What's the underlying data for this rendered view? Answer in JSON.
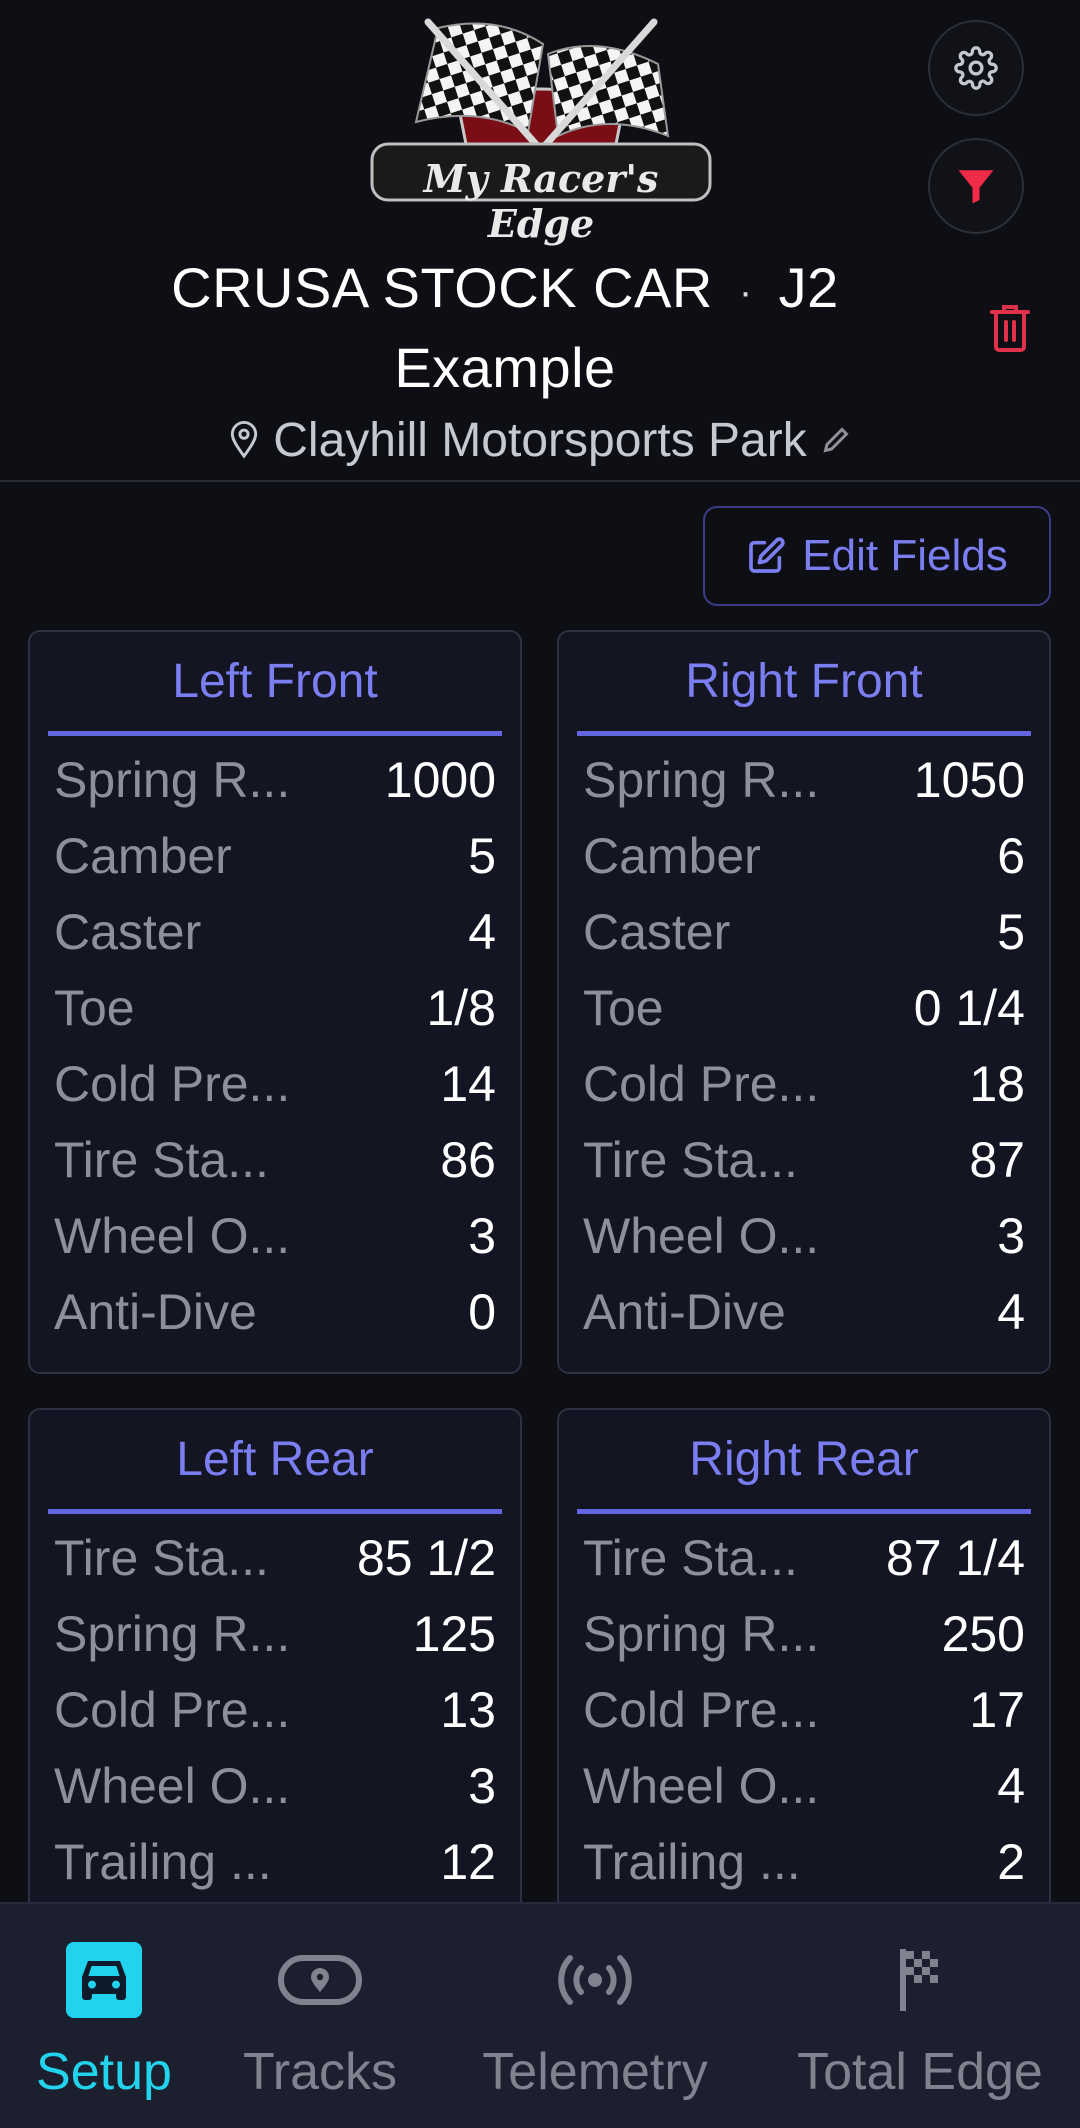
{
  "header": {
    "logo_text": "My Racer's Edge",
    "title_line1_left": "CRUSA STOCK CAR",
    "title_separator": "·",
    "title_line1_right": "J2",
    "title_line2": "Example",
    "location": "Clayhill Motorsports Park",
    "icons": {
      "settings": "gear-icon",
      "filter": "filter-icon",
      "delete": "trash-icon",
      "location": "map-pin-icon",
      "edit_location": "pencil-icon"
    },
    "colors": {
      "filter": "#ef2b45",
      "delete": "#e0314b"
    }
  },
  "edit_fields": {
    "label": "Edit Fields",
    "icon": "edit-square-icon"
  },
  "cards": {
    "left_front": {
      "title": "Left Front",
      "rows": [
        {
          "label": "Spring R...",
          "value": "1000"
        },
        {
          "label": "Camber",
          "value": "5"
        },
        {
          "label": "Caster",
          "value": "4"
        },
        {
          "label": "Toe",
          "value": "1/8"
        },
        {
          "label": "Cold Pre...",
          "value": "14"
        },
        {
          "label": "Tire Sta...",
          "value": "86"
        },
        {
          "label": "Wheel O...",
          "value": "3"
        },
        {
          "label": "Anti-Dive",
          "value": "0"
        }
      ]
    },
    "right_front": {
      "title": "Right Front",
      "rows": [
        {
          "label": "Spring R...",
          "value": "1050"
        },
        {
          "label": "Camber",
          "value": "6"
        },
        {
          "label": "Caster",
          "value": "5"
        },
        {
          "label": "Toe",
          "value": "0 1/4"
        },
        {
          "label": "Cold Pre...",
          "value": "18"
        },
        {
          "label": "Tire Sta...",
          "value": "87"
        },
        {
          "label": "Wheel O...",
          "value": "3"
        },
        {
          "label": "Anti-Dive",
          "value": "4"
        }
      ]
    },
    "left_rear": {
      "title": "Left Rear",
      "rows": [
        {
          "label": "Tire Sta...",
          "value": "85 1/2"
        },
        {
          "label": "Spring R...",
          "value": "125"
        },
        {
          "label": "Cold Pre...",
          "value": "13"
        },
        {
          "label": "Wheel O...",
          "value": "3"
        },
        {
          "label": "Trailing ...",
          "value": "12"
        }
      ]
    },
    "right_rear": {
      "title": "Right Rear",
      "rows": [
        {
          "label": "Tire Sta...",
          "value": "87 1/4"
        },
        {
          "label": "Spring R...",
          "value": "250"
        },
        {
          "label": "Cold Pre...",
          "value": "17"
        },
        {
          "label": "Wheel O...",
          "value": "4"
        },
        {
          "label": "Trailing ...",
          "value": "2"
        }
      ]
    }
  },
  "bottom_nav": {
    "items": [
      {
        "label": "Setup",
        "icon": "car-icon",
        "active": true
      },
      {
        "label": "Tracks",
        "icon": "track-icon",
        "active": false
      },
      {
        "label": "Telemetry",
        "icon": "broadcast-icon",
        "active": false
      },
      {
        "label": "Total Edge",
        "icon": "checkered-flag-icon",
        "active": false
      }
    ],
    "active_color": "#22d3ee"
  }
}
